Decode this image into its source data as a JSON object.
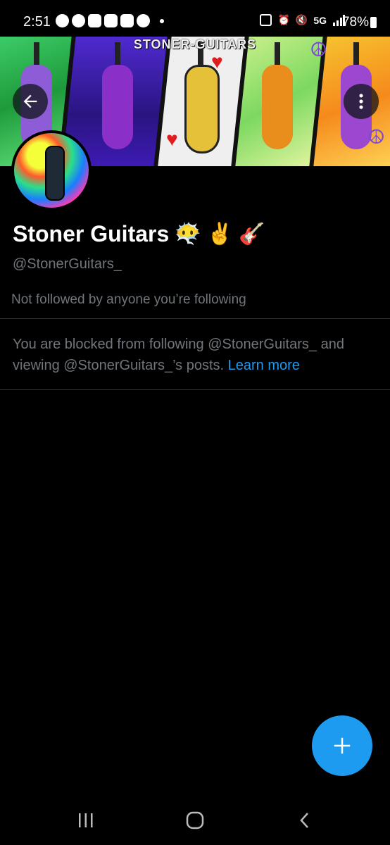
{
  "status_bar": {
    "time": "2:51",
    "network": "5G",
    "battery": "78%"
  },
  "banner": {
    "title": "STONER-GUITARS"
  },
  "profile": {
    "display_name": "Stoner Guitars",
    "name_emojis": [
      "😶‍🌫️",
      "✌️",
      "🎸"
    ],
    "handle": "@StonerGuitars_",
    "followed_by_text": "Not followed by anyone you’re following"
  },
  "blocked_notice": {
    "text": "You are blocked from following @StonerGuitars_ and viewing @StonerGuitars_’s posts.",
    "link_label": "Learn more"
  },
  "fab": {
    "icon": "plus-icon",
    "color": "#1d9bf0"
  },
  "colors": {
    "accent": "#1d9bf0",
    "background": "#000000",
    "secondary_text": "#71767b",
    "divider": "#2f3336"
  },
  "icons": {
    "back": "arrow-left-icon",
    "more": "more-vertical-icon",
    "nav_recents": "recents-icon",
    "nav_home": "home-icon",
    "nav_back": "back-icon"
  }
}
